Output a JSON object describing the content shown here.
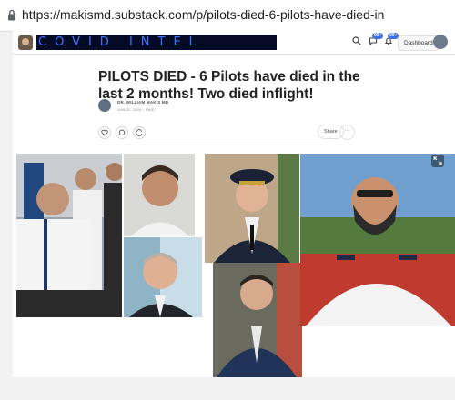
{
  "browser": {
    "url": "https://makismd.substack.com/p/pilots-died-6-pilots-have-died-in"
  },
  "header": {
    "banner_text": "COVID INTEL",
    "notification_badge_1": "99+",
    "notification_badge_2": "99+",
    "dashboard_label": "Dashboard"
  },
  "post": {
    "title": "PILOTS DIED - 6 Pilots have died in the last 2 months! Two died inflight!",
    "author": "DR. WILLIAM MAKIS MD",
    "date": "JUN 22, 2024 · PAID",
    "share_label": "Share",
    "more_label": "···"
  },
  "icons": {
    "lock": "lock-icon",
    "search": "search-icon",
    "like": "heart-icon",
    "comment": "comment-icon",
    "restack": "restack-icon",
    "expand": "expand-icon"
  },
  "colors": {
    "banner_bg": "#050b24",
    "banner_text": "#3f73ff",
    "badge": "#3f6fe5"
  }
}
